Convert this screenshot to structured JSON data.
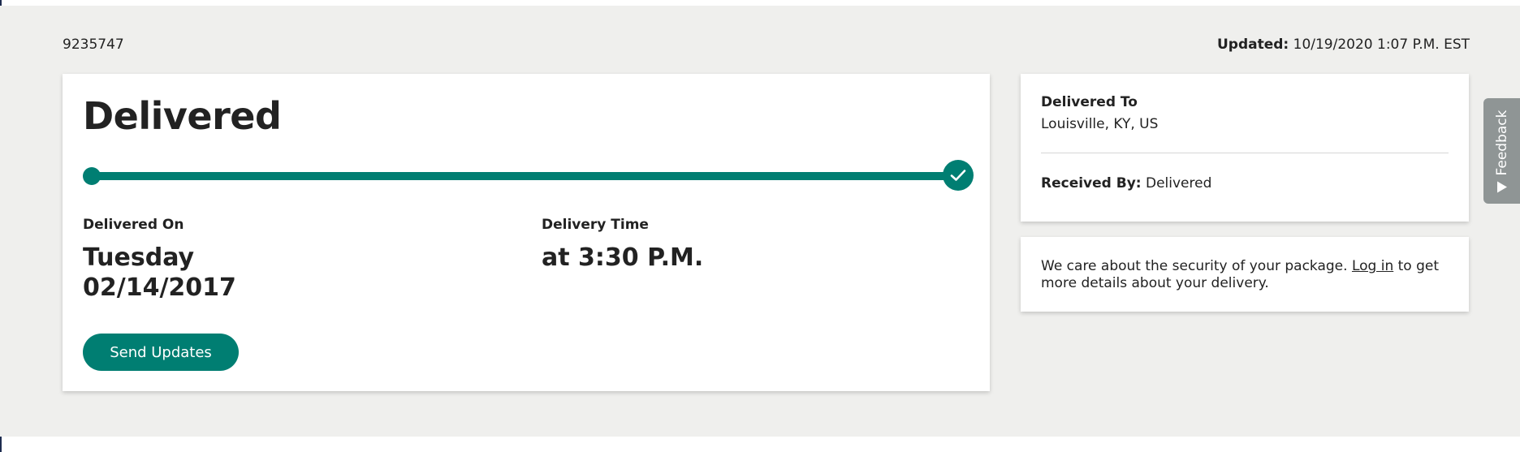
{
  "header": {
    "tracking_number": "9235747",
    "updated_label": "Updated:",
    "updated_value": "10/19/2020 1:07 P.M. EST"
  },
  "status": {
    "title": "Delivered",
    "progress_fraction": 1.0,
    "delivered_on_label": "Delivered On",
    "delivered_day": "Tuesday",
    "delivered_date": "02/14/2017",
    "delivery_time_label": "Delivery Time",
    "delivery_time_value": "at 3:30 P.M.",
    "send_updates_label": "Send Updates"
  },
  "delivery_info": {
    "delivered_to_label": "Delivered To",
    "delivered_to_value": "Louisville, KY, US",
    "received_by_label": "Received By:",
    "received_by_value": "Delivered"
  },
  "security": {
    "text_before": "We care about the security of your package.",
    "login_link": "Log in",
    "text_after": "to get more details about your delivery."
  },
  "feedback": {
    "label": "Feedback",
    "icon": "triangle-up-icon"
  },
  "colors": {
    "accent": "#007e72",
    "background": "#efefed",
    "feedback_tab": "#8f9595"
  }
}
